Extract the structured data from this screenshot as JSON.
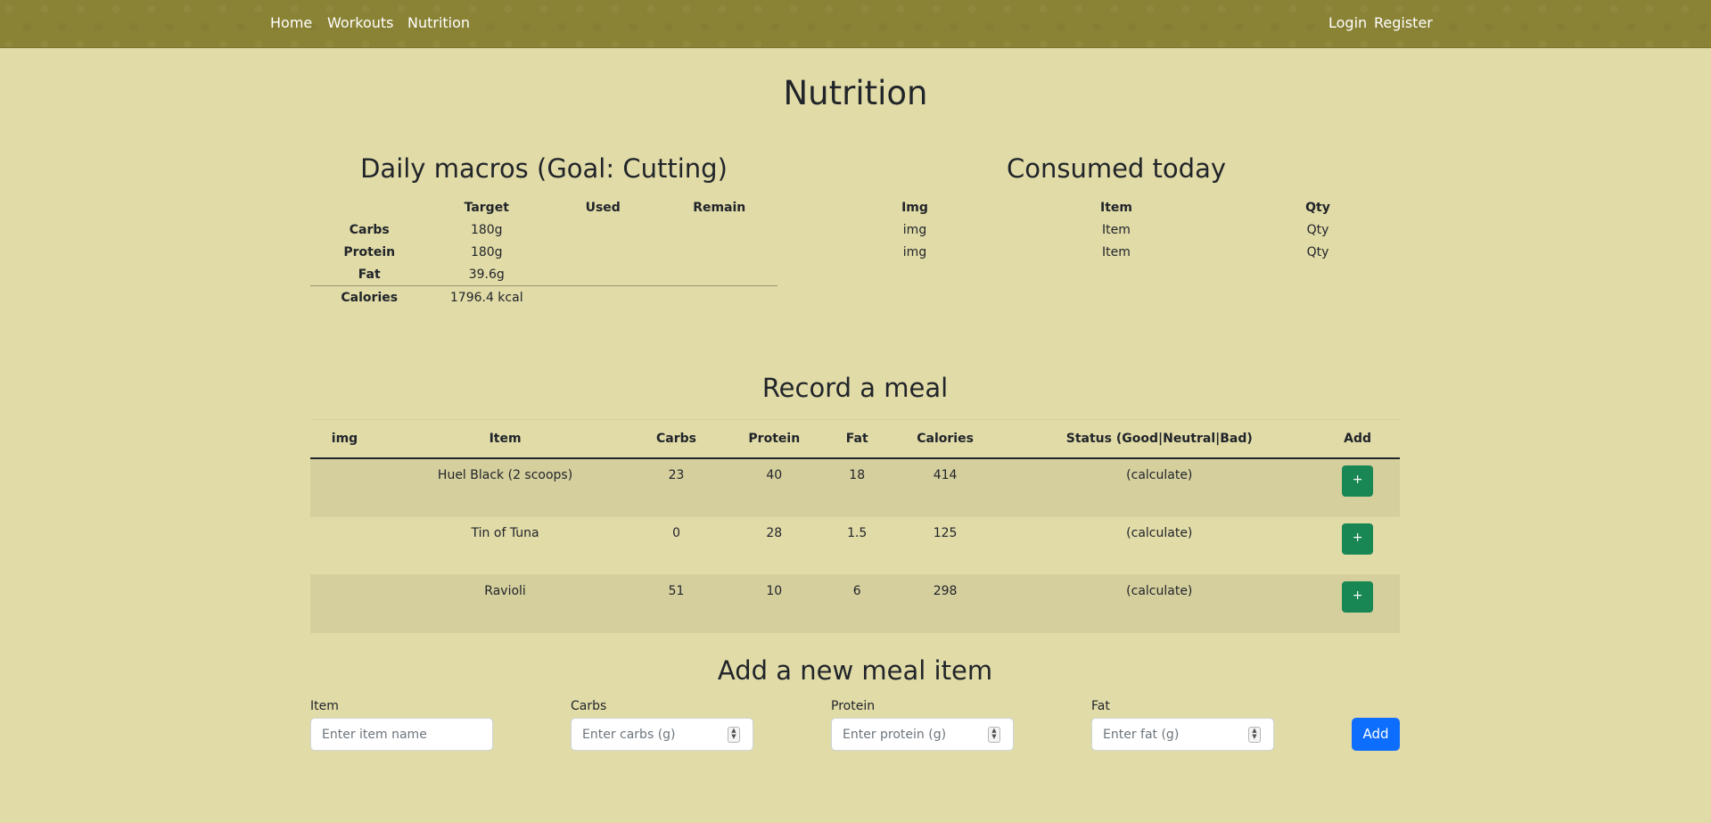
{
  "nav": {
    "left": [
      "Home",
      "Workouts",
      "Nutrition"
    ],
    "login": "Login",
    "register": "Register"
  },
  "page_title": "Nutrition",
  "macros": {
    "title": "Daily macros (Goal: Cutting)",
    "headers": [
      "",
      "Target",
      "Used",
      "Remain"
    ],
    "rows": [
      {
        "label": "Carbs",
        "target": "180g",
        "used": "",
        "remain": ""
      },
      {
        "label": "Protein",
        "target": "180g",
        "used": "",
        "remain": ""
      },
      {
        "label": "Fat",
        "target": "39.6g",
        "used": "",
        "remain": ""
      }
    ],
    "total": {
      "label": "Calories",
      "target": "1796.4 kcal",
      "used": "",
      "remain": ""
    }
  },
  "consumed": {
    "title": "Consumed today",
    "headers": [
      "Img",
      "Item",
      "Qty"
    ],
    "rows": [
      [
        "img",
        "Item",
        "Qty"
      ],
      [
        "img",
        "Item",
        "Qty"
      ]
    ]
  },
  "record": {
    "title": "Record a meal",
    "headers": [
      "img",
      "Item",
      "Carbs",
      "Protein",
      "Fat",
      "Calories",
      "Status (Good|Neutral|Bad)",
      "Add"
    ],
    "rows": [
      {
        "img": "",
        "item": "Huel Black (2 scoops)",
        "carbs": "23",
        "protein": "40",
        "fat": "18",
        "calories": "414",
        "status": "(calculate)",
        "add": "+"
      },
      {
        "img": "",
        "item": "Tin of Tuna",
        "carbs": "0",
        "protein": "28",
        "fat": "1.5",
        "calories": "125",
        "status": "(calculate)",
        "add": "+"
      },
      {
        "img": "",
        "item": "Ravioli",
        "carbs": "51",
        "protein": "10",
        "fat": "6",
        "calories": "298",
        "status": "(calculate)",
        "add": "+"
      }
    ]
  },
  "new_item": {
    "title": "Add a new meal item",
    "fields": [
      {
        "label": "Item",
        "placeholder": "Enter item name"
      },
      {
        "label": "Carbs",
        "placeholder": "Enter carbs (g)"
      },
      {
        "label": "Protein",
        "placeholder": "Enter protein (g)"
      },
      {
        "label": "Fat",
        "placeholder": "Enter fat (g)"
      }
    ],
    "submit": "Add"
  },
  "colors": {
    "navbar": "#8a8335",
    "background": "#e1dba8",
    "add_row_button": "#198754",
    "primary_button": "#0d6efd"
  }
}
